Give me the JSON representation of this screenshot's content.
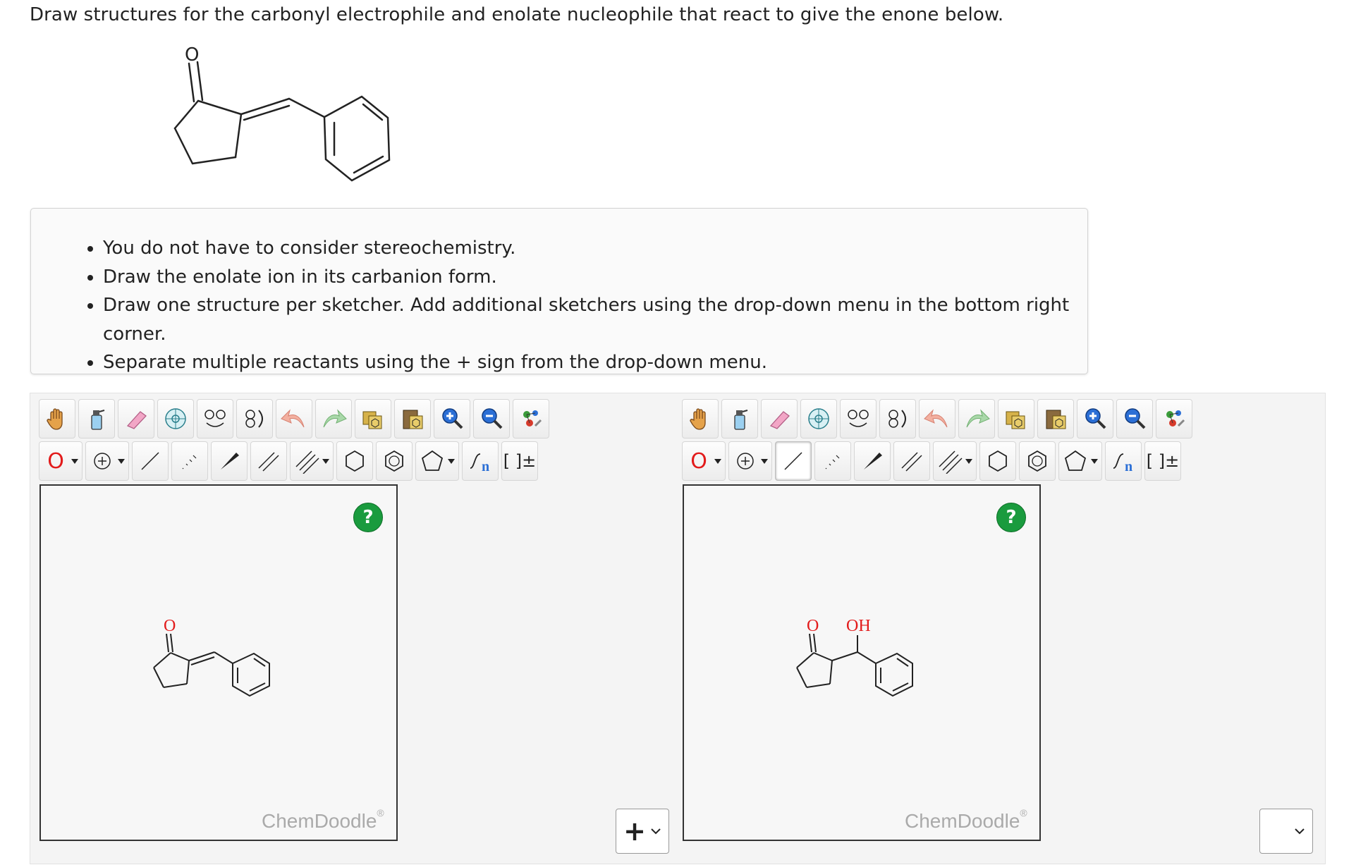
{
  "question": "Draw structures for the carbonyl electrophile and enolate nucleophile that react to give the enone below.",
  "product_structure": {
    "atom_label": "O"
  },
  "instructions": [
    "You do not have to consider stereochemistry.",
    "Draw the enolate ion in its carbanion form.",
    "Draw one structure per sketcher. Add additional sketchers using the drop-down menu in the bottom right corner.",
    "Separate multiple reactants using the + sign from the drop-down menu."
  ],
  "toolbar": {
    "element_label": "O",
    "chain_label": "n",
    "bracket_label": "[ ]±"
  },
  "sketchers": [
    {
      "help_label": "?",
      "brand": "ChemDoodle",
      "brand_mark": "®",
      "atom_labels": [
        "O"
      ]
    },
    {
      "help_label": "?",
      "brand": "ChemDoodle",
      "brand_mark": "®",
      "atom_labels": [
        "O",
        "OH"
      ]
    }
  ],
  "separator_select": {
    "value": "+"
  },
  "add_sketcher_select": {
    "value": ""
  },
  "colors": {
    "help_green": "#1a9b3e",
    "oxygen_red": "#e21b1b",
    "brand_gray": "#aaaaaa"
  }
}
